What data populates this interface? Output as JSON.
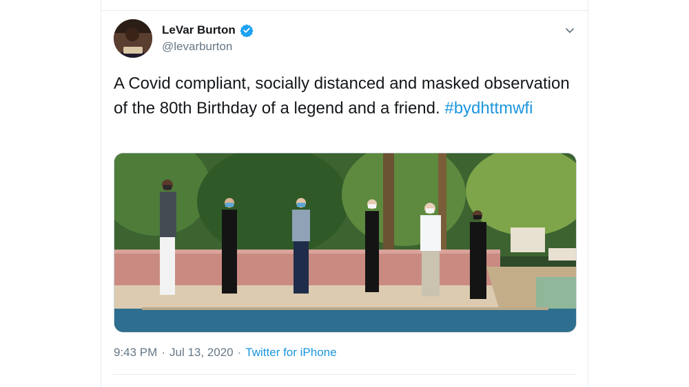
{
  "author": {
    "display_name": "LeVar Burton",
    "handle": "@levarburton",
    "verified": true,
    "avatar_icon": "user-avatar"
  },
  "menu": {
    "icon": "chevron-down-icon"
  },
  "tweet": {
    "text": "A Covid compliant, socially distanced and masked observation of the 80th Birthday of a legend and a friend.",
    "hashtag": "#bydhttmwfi"
  },
  "media": {
    "people_count": 6
  },
  "meta": {
    "time": "9:43 PM",
    "separator": "·",
    "date": "Jul 13, 2020",
    "source": "Twitter for iPhone"
  },
  "colors": {
    "link": "#1b95e0",
    "text": "#14171a",
    "secondary": "#657786",
    "border": "#e6ecf0"
  }
}
